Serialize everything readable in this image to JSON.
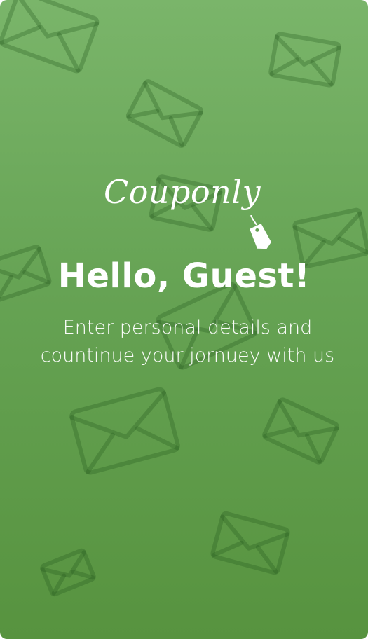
{
  "brand": {
    "name": "Couponly"
  },
  "greeting": {
    "title": "Hello, Guest!"
  },
  "message": {
    "line1": "Enter personal details and",
    "line2": "countinue your jornuey with us"
  },
  "colors": {
    "background_top": "#7ab56a",
    "background_bottom": "#57933f",
    "text": "#ffffff"
  },
  "icons": [
    "envelope-icon",
    "price-tag-icon"
  ]
}
